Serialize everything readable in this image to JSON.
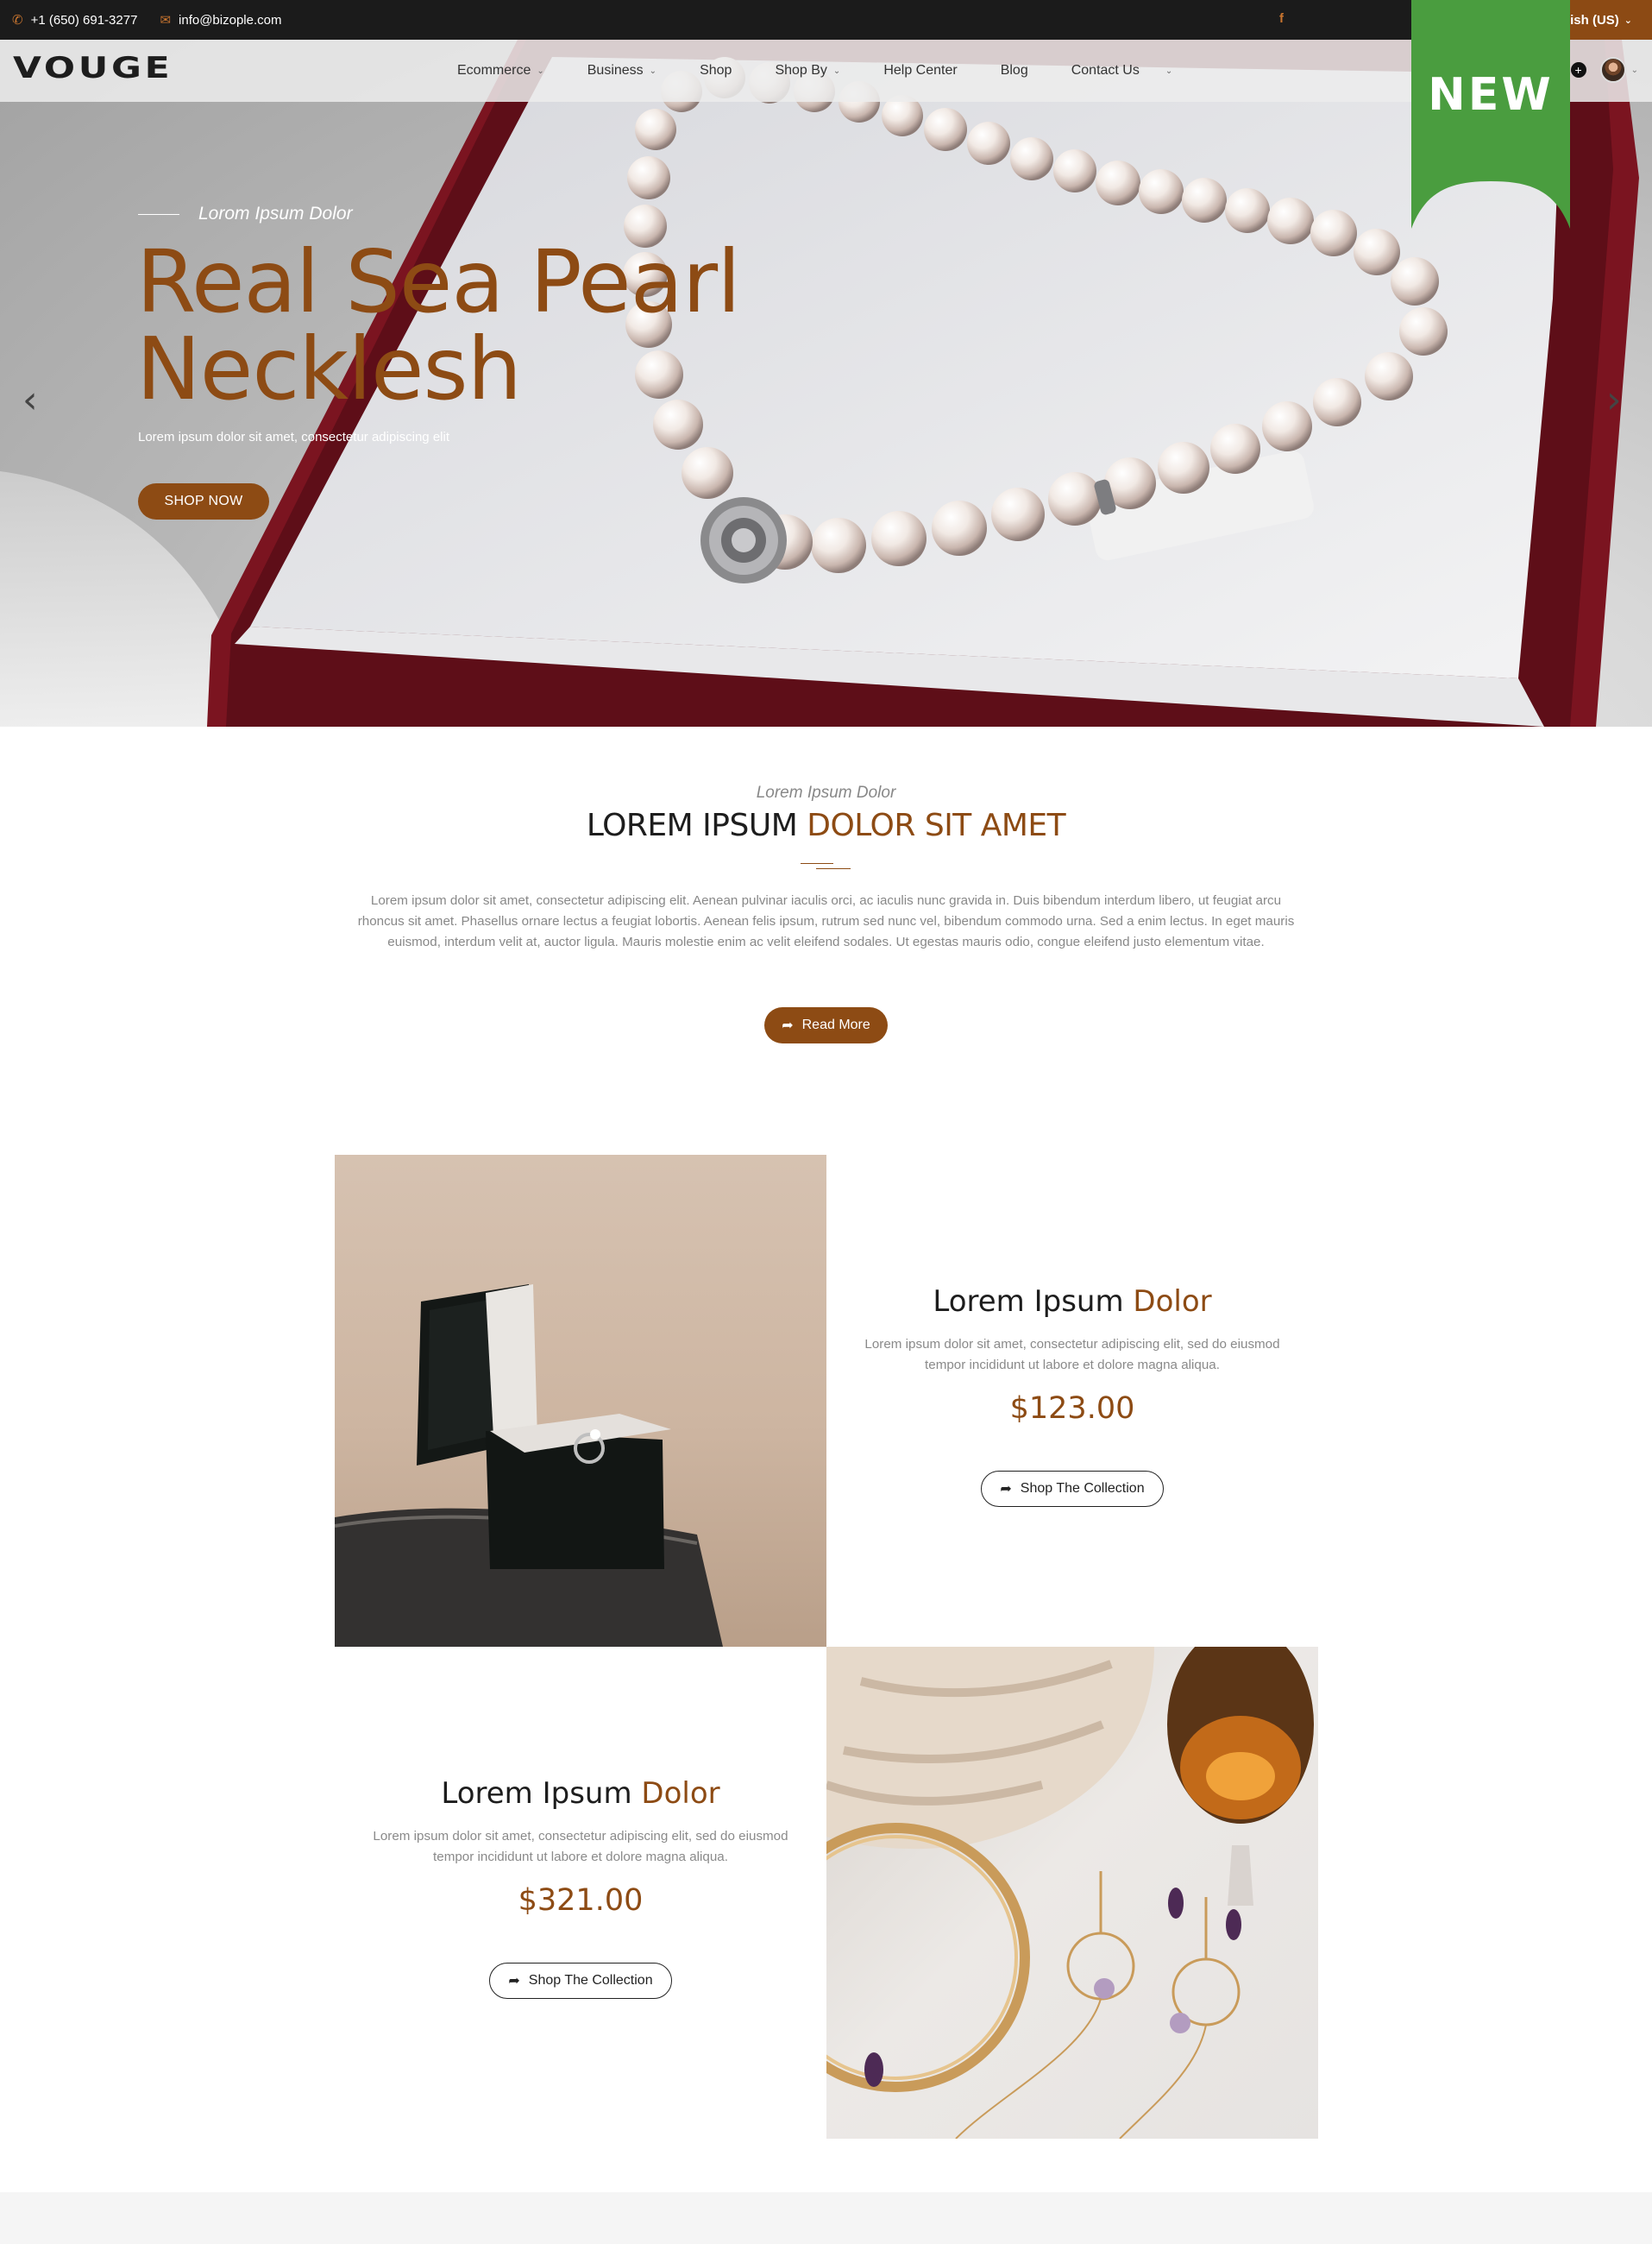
{
  "topbar": {
    "phone": "+1 (650) 691-3277",
    "email": "info@bizople.com",
    "language": "lish (US)"
  },
  "header": {
    "logo": "VOUGE",
    "nav": [
      {
        "label": "Ecommerce",
        "dropdown": true
      },
      {
        "label": "Business",
        "dropdown": true
      },
      {
        "label": "Shop",
        "dropdown": false
      },
      {
        "label": "Shop By",
        "dropdown": true
      },
      {
        "label": "Help Center",
        "dropdown": false
      },
      {
        "label": "Blog",
        "dropdown": false
      },
      {
        "label": "Contact Us",
        "dropdown": false
      }
    ]
  },
  "ribbon": {
    "label": "NEW",
    "color": "#4a9d3f"
  },
  "hero": {
    "eyebrow": "Lorom Ipsum Dolor",
    "title": "Real Sea Pearl Necklesh",
    "subtitle": "Lorem ipsum dolor sit amet, consectetur adipiscing elit",
    "button": "SHOP NOW",
    "prev_icon": "chevron-left-icon",
    "next_icon": "chevron-right-icon"
  },
  "intro": {
    "eyebrow": "Lorem Ipsum Dolor",
    "title_plain": "LOREM IPSUM ",
    "title_accent": "DOLOR SIT AMET",
    "text": "Lorem ipsum dolor sit amet, consectetur adipiscing elit. Aenean pulvinar iaculis orci, ac iaculis nunc gravida in. Duis bibendum interdum libero, ut feugiat arcu rhoncus sit amet. Phasellus ornare lectus a feugiat lobortis. Aenean felis ipsum, rutrum sed nunc vel, bibendum commodo urna. Sed a enim lectus. In eget mauris euismod, interdum velit at, auctor ligula. Mauris molestie enim ac velit eleifend sodales. Ut egestas mauris odio, congue eleifend justo elementum vitae.",
    "button": "Read More"
  },
  "products": [
    {
      "title_plain": "Lorem Ipsum ",
      "title_accent": "Dolor",
      "description": "Lorem ipsum dolor sit amet, consectetur adipiscing elit, sed do eiusmod tempor incididunt ut labore et dolore magna aliqua.",
      "price": "$123.00",
      "button": "Shop The Collection"
    },
    {
      "title_plain": "Lorem Ipsum ",
      "title_accent": "Dolor",
      "description": "Lorem ipsum dolor sit amet, consectetur adipiscing elit, sed do eiusmod tempor incididunt ut labore et dolore magna aliqua.",
      "price": "$321.00",
      "button": "Shop The Collection"
    }
  ],
  "colors": {
    "accent": "#8d4b14",
    "topbar": "#1b1b1b",
    "ribbon": "#4a9d3f"
  }
}
